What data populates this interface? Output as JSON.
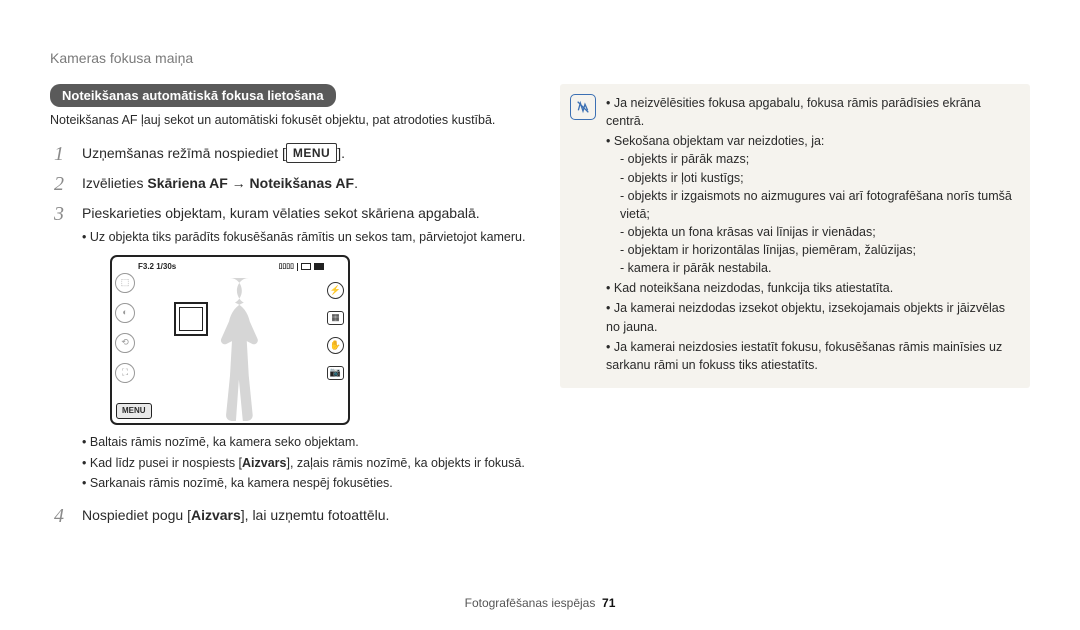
{
  "breadcrumb": "Kameras fokusa maiņa",
  "section_header": "Noteikšanas automātiskā fokusa lietošana",
  "intro": "Noteikšanas AF ļauj sekot un automātiski fokusēt objektu, pat atrodoties kustībā.",
  "steps": {
    "s1_pre": "Uzņemšanas režīmā nospiediet [",
    "s1_btn": "MENU",
    "s1_post": "].",
    "s2_pre": "Izvēlieties ",
    "s2_bold1": "Skāriena AF",
    "s2_arrow": " → ",
    "s2_bold2": "Noteikšanas AF",
    "s2_post": ".",
    "s3": "Pieskarieties objektam, kuram vēlaties sekot skāriena apgabalā.",
    "s3_sub1": "Uz objekta tiks parādīts fokusēšanās rāmītis un sekos tam, pārvietojot kameru.",
    "s3_sub2": "Baltais rāmis nozīmē, ka kamera seko objektam.",
    "s3_sub3_pre": "Kad līdz pusei ir nospiests [",
    "s3_sub3_bold": "Aizvars",
    "s3_sub3_post": "], zaļais rāmis nozīmē, ka objekts ir fokusā.",
    "s3_sub4": "Sarkanais rāmis nozīmē, ka kamera nespēj fokusēties.",
    "s4_pre": "Nospiediet pogu [",
    "s4_bold": "Aizvars",
    "s4_post": "], lai uzņemtu fotoattēlu."
  },
  "cam": {
    "top_left": "F3.2 1/30s",
    "menu_btn": "MENU"
  },
  "note": {
    "b1": "Ja neizvēlēsities fokusa apgabalu, fokusa rāmis parādīsies ekrāna centrā.",
    "b2": "Sekošana objektam var neizdoties, ja:",
    "d1": "objekts ir pārāk mazs;",
    "d2": "objekts ir ļoti kustīgs;",
    "d3": "objekts ir izgaismots no aizmugures vai arī fotografēšana norīs tumšā vietā;",
    "d4": "objekta un fona krāsas vai līnijas ir vienādas;",
    "d5": "objektam ir horizontālas līnijas, piemēram, žalūzijas;",
    "d6": "kamera ir pārāk nestabila.",
    "b3": "Kad noteikšana neizdodas, funkcija tiks atiestatīta.",
    "b4": "Ja kamerai neizdodas izsekot objektu, izsekojamais objekts ir jāizvēlas no jauna.",
    "b5": "Ja kamerai neizdosies iestatīt fokusu, fokusēšanas rāmis mainīsies uz sarkanu rāmi un fokuss tiks atiestatīts."
  },
  "footer": {
    "label": "Fotografēšanas iespējas",
    "page": "71"
  }
}
